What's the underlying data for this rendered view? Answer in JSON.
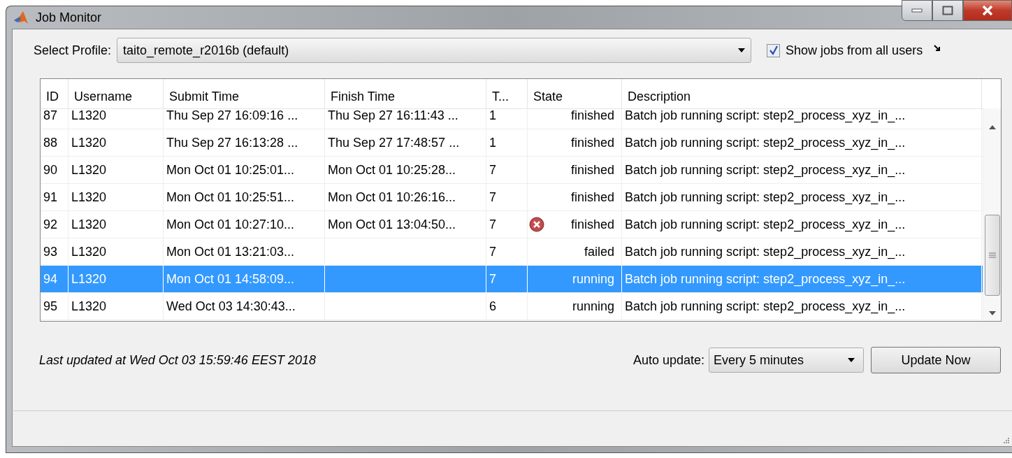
{
  "window": {
    "title": "Job Monitor"
  },
  "profile": {
    "label": "Select Profile:",
    "value": "taito_remote_r2016b (default)"
  },
  "show_all_users": {
    "label": "Show jobs from all users",
    "checked": true
  },
  "table": {
    "columns": [
      "ID",
      "Username",
      "Submit Time",
      "Finish Time",
      "T...",
      "State",
      "Description"
    ],
    "rows": [
      {
        "id": "87",
        "username": "L1320",
        "submit": "Thu Sep 27 16:09:16 ...",
        "finish": "Thu Sep 27 16:11:43 ...",
        "tasks": "1",
        "state": "finished",
        "error_icon": false,
        "description": "Batch job running script: step2_process_xyz_in_...",
        "selected": false
      },
      {
        "id": "88",
        "username": "L1320",
        "submit": "Thu Sep 27 16:13:28 ...",
        "finish": "Thu Sep 27 17:48:57 ...",
        "tasks": "1",
        "state": "finished",
        "error_icon": false,
        "description": "Batch job running script: step2_process_xyz_in_...",
        "selected": false
      },
      {
        "id": "90",
        "username": "L1320",
        "submit": "Mon Oct 01 10:25:01...",
        "finish": "Mon Oct 01 10:25:28...",
        "tasks": "7",
        "state": "finished",
        "error_icon": false,
        "description": "Batch job running script: step2_process_xyz_in_...",
        "selected": false
      },
      {
        "id": "91",
        "username": "L1320",
        "submit": "Mon Oct 01 10:25:51...",
        "finish": "Mon Oct 01 10:26:16...",
        "tasks": "7",
        "state": "finished",
        "error_icon": false,
        "description": "Batch job running script: step2_process_xyz_in_...",
        "selected": false
      },
      {
        "id": "92",
        "username": "L1320",
        "submit": "Mon Oct 01 10:27:10...",
        "finish": "Mon Oct 01 13:04:50...",
        "tasks": "7",
        "state": "finished",
        "error_icon": true,
        "description": "Batch job running script: step2_process_xyz_in_...",
        "selected": false
      },
      {
        "id": "93",
        "username": "L1320",
        "submit": "Mon Oct 01 13:21:03...",
        "tasks": "7",
        "state": "failed",
        "error_icon": false,
        "description": "Batch job running script: step2_process_xyz_in_...",
        "selected": false
      },
      {
        "id": "94",
        "username": "L1320",
        "submit": "Mon Oct 01 14:58:09...",
        "tasks": "7",
        "state": "running",
        "error_icon": false,
        "description": "Batch job running script: step2_process_xyz_in_...",
        "selected": true
      },
      {
        "id": "95",
        "username": "L1320",
        "submit": "Wed Oct 03 14:30:43...",
        "tasks": "6",
        "state": "running",
        "error_icon": false,
        "description": "Batch job running script: step2_process_xyz_in_...",
        "selected": false
      }
    ]
  },
  "last_updated": "Last updated at Wed Oct 03 15:59:46 EEST 2018",
  "auto_update": {
    "label": "Auto update:",
    "value": "Every 5 minutes"
  },
  "buttons": [
    "Update Now"
  ]
}
